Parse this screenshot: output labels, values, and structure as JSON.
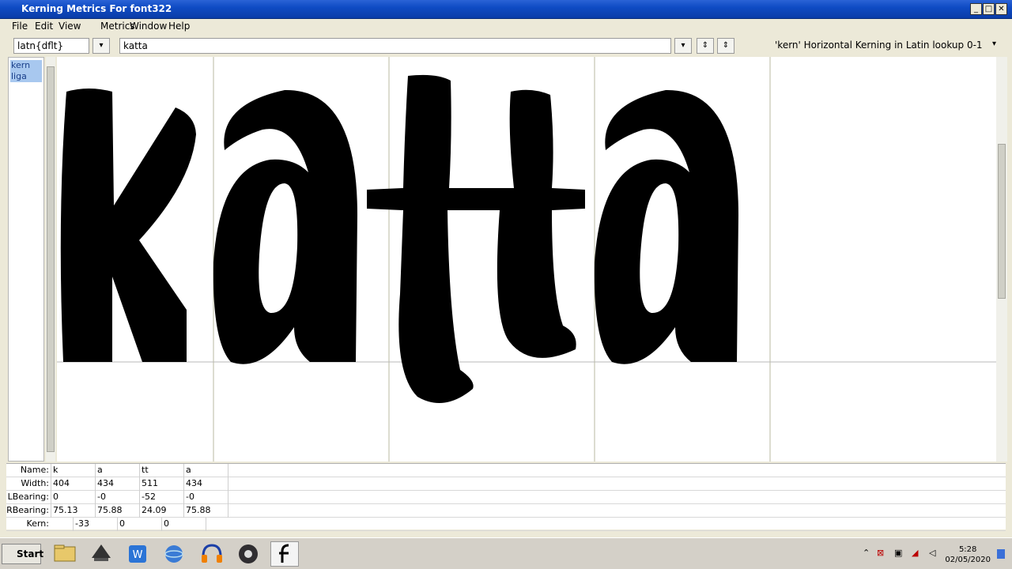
{
  "window": {
    "title": "Kerning Metrics For font322",
    "minimize": "_",
    "maximize": "□",
    "close": "✕"
  },
  "menu": [
    "File",
    "Edit",
    "View",
    "Metrics",
    "Window",
    "Help"
  ],
  "toolbar": {
    "script_lang": "latn{dflt}",
    "text": "katta",
    "lookup": "'kern' Horizontal Kerning in Latin lookup 0-1"
  },
  "features": [
    "kern",
    "liga"
  ],
  "glyph_display": "katta",
  "metrics": {
    "labels": [
      "Name:",
      "Width:",
      "LBearing:",
      "RBearing:",
      "Kern:"
    ],
    "name": [
      "k",
      "a",
      "tt",
      "a"
    ],
    "width": [
      "404",
      "434",
      "511",
      "434"
    ],
    "lbearing": [
      "0",
      "-0",
      "-52",
      "-0"
    ],
    "rbearing": [
      "75.13",
      "75.88",
      "24.09",
      "75.88"
    ],
    "kern": [
      "-33",
      "0",
      "0"
    ]
  },
  "taskbar": {
    "start": "Start",
    "icons": [
      "file-manager-icon",
      "inkscape-icon",
      "word-icon",
      "browser-icon",
      "audacity-icon",
      "obs-icon",
      "fontforge-icon"
    ],
    "time": "5:28",
    "date": "02/05/2020"
  }
}
